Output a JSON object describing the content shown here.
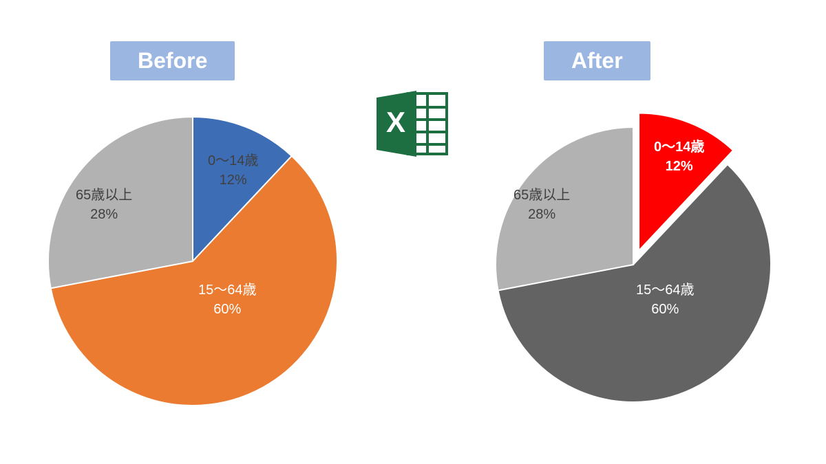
{
  "titles": {
    "before": "Before",
    "after": "After"
  },
  "chart_data": [
    {
      "type": "pie",
      "title": "Before",
      "series": [
        {
          "name": "0～14歳",
          "value": 12,
          "percent_label": "12%",
          "color": "#3d6db5"
        },
        {
          "name": "15～64歳",
          "value": 60,
          "percent_label": "60%",
          "color": "#eb7b30"
        },
        {
          "name": "65歳以上",
          "value": 28,
          "percent_label": "28%",
          "color": "#b2b2b2"
        }
      ]
    },
    {
      "type": "pie",
      "title": "After",
      "exploded_slice": "0～14歳",
      "series": [
        {
          "name": "0～14歳",
          "value": 12,
          "percent_label": "12%",
          "color": "#ff0000",
          "exploded": true,
          "label_color": "#ffffff",
          "label_bold": true
        },
        {
          "name": "15～64歳",
          "value": 60,
          "percent_label": "60%",
          "color": "#636363"
        },
        {
          "name": "65歳以上",
          "value": 28,
          "percent_label": "28%",
          "color": "#b2b2b2"
        }
      ]
    }
  ],
  "icon": {
    "name": "excel-icon",
    "letter": "X",
    "fill": "#1d6f42"
  }
}
